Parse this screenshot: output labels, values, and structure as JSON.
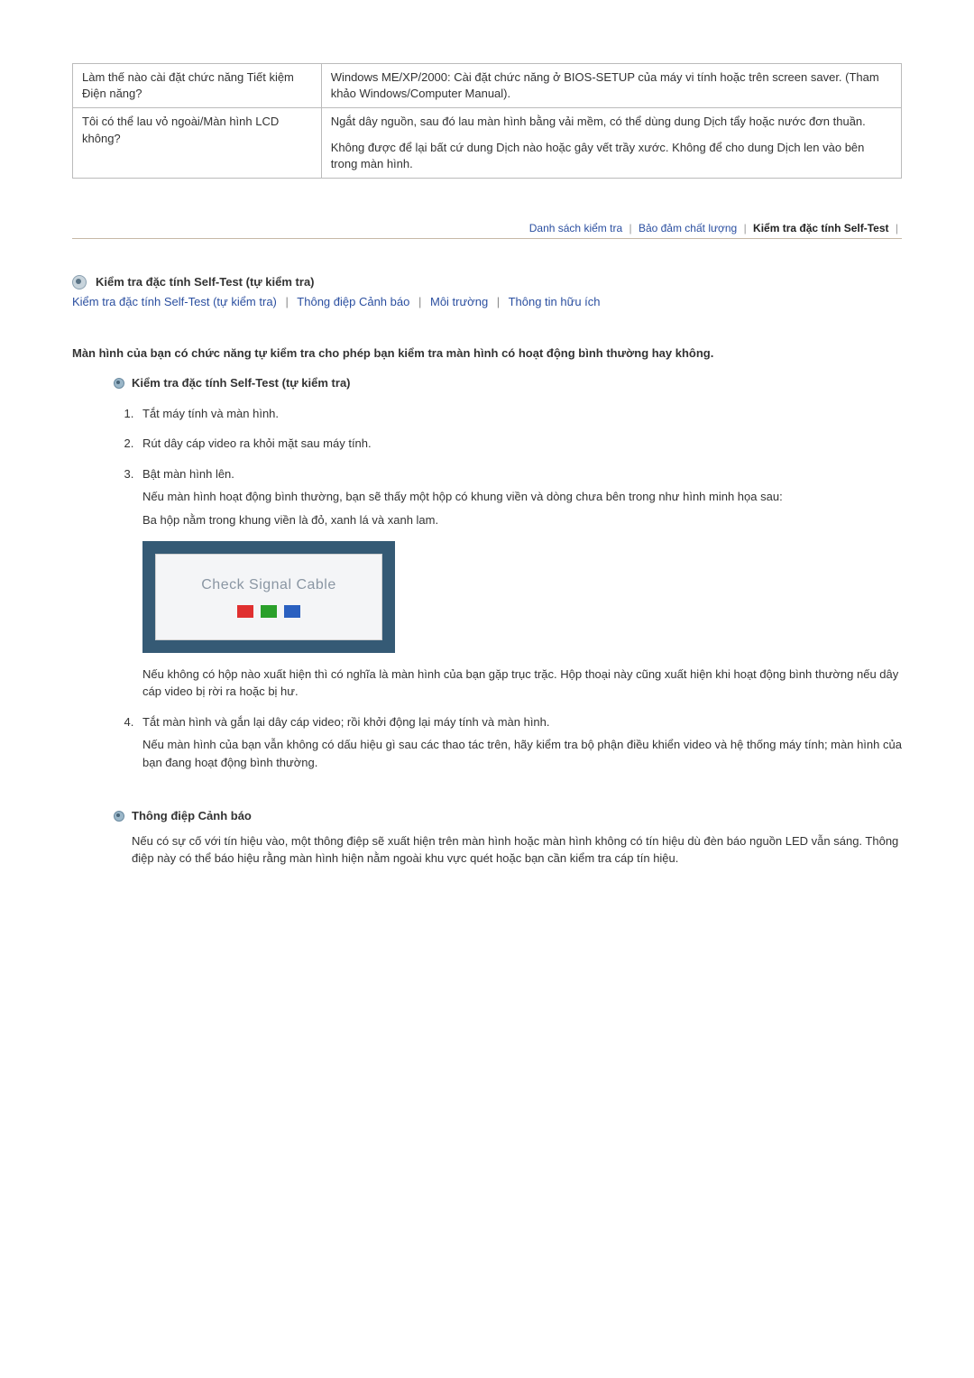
{
  "faq": {
    "rows": [
      {
        "q": "Làm thế nào cài đặt chức năng Tiết kiệm Điện năng?",
        "a": [
          "Windows ME/XP/2000: Cài đặt chức năng ở BIOS-SETUP của máy vi tính hoặc trên screen saver. (Tham khảo Windows/Computer Manual)."
        ]
      },
      {
        "q": "Tôi có thể lau vỏ ngoài/Màn hình LCD không?",
        "a": [
          "Ngắt dây nguồn, sau đó lau màn hình bằng vải mềm, có thể dùng dung Dịch tẩy hoặc nước đơn thuần.",
          "Không được để lại bất cứ dung Dịch nào hoặc gây vết trầy xước. Không để cho dung Dịch len vào bên trong màn hình."
        ]
      }
    ]
  },
  "tabs": {
    "items": [
      "Danh sách kiểm tra",
      "Bảo đảm chất lượng",
      "Kiểm tra đặc tính Self-Test"
    ],
    "activeIndex": 2
  },
  "section": {
    "title": "Kiểm tra đặc tính Self-Test (tự kiểm tra)",
    "subnav": [
      "Kiểm tra đặc tính Self-Test (tự kiểm tra)",
      "Thông điệp Cảnh báo",
      "Môi trường",
      "Thông tin hữu ích"
    ]
  },
  "intro": "Màn hình của bạn có chức năng tự kiểm tra cho phép bạn kiểm tra màn hình có hoạt động bình thường hay không.",
  "selftest": {
    "heading": "Kiểm tra đặc tính Self-Test (tự kiểm tra)",
    "steps": {
      "s1": "Tắt máy tính và màn hình.",
      "s2": "Rút dây cáp video ra khỏi mặt sau máy tính.",
      "s3": "Bật màn hình lên.",
      "s3p1": "Nếu màn hình hoạt động bình thường, bạn sẽ thấy một hộp có khung viền và dòng chưa bên trong như hình minh họa sau:",
      "s3p2": "Ba hộp nằm trong khung viền là đỏ, xanh lá và xanh lam.",
      "signal_label": "Check Signal Cable",
      "s3p3": "Nếu không có hộp nào xuất hiện thì có nghĩa là màn hình của bạn gặp trục trặc. Hộp thoại này cũng xuất hiện khi hoạt động bình thường nếu dây cáp video bị rời ra hoặc bị hư.",
      "s4": "Tắt màn hình và gắn lại dây cáp video; rồi khởi động lại máy tính và màn hình.",
      "s4p1": "Nếu màn hình của bạn vẫn không có dấu hiệu gì sau các thao tác trên, hãy kiểm tra bộ phận điều khiển video và hệ thống máy tính; màn hình của bạn đang hoạt động bình thường."
    }
  },
  "warning": {
    "heading": "Thông điệp Cảnh báo",
    "body": "Nếu có sự cố với tín hiệu vào, một thông điệp sẽ xuất hiện trên màn hình hoặc màn hình không có tín hiệu dù đèn báo nguồn LED vẫn sáng. Thông điệp này có thể báo hiệu rằng màn hình hiện nằm ngoài khu vực quét hoặc bạn cần kiểm tra cáp tín hiệu."
  }
}
